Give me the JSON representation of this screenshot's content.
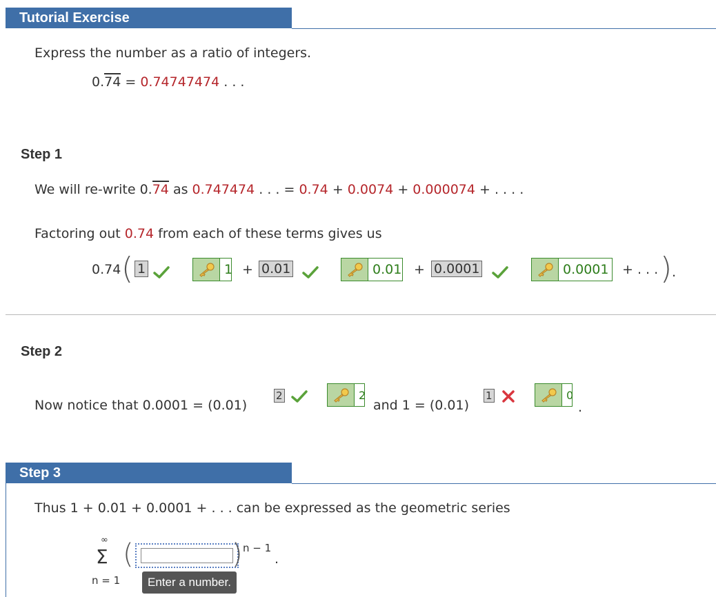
{
  "header": {
    "title": "Tutorial Exercise"
  },
  "problem": {
    "prompt": "Express the number as a ratio of integers.",
    "lhs_int": "0.",
    "lhs_rep": "74",
    "eq": "=",
    "rhs": "0.74747474",
    "dots": ". . ."
  },
  "step1": {
    "heading": "Step 1",
    "rewrite": {
      "t1": "We will re-write 0.",
      "rep": "74",
      "t2": "as",
      "v1": "0.747474",
      "t3": ". . . =",
      "a": "0.74",
      "p1": "+",
      "b": "0.0074",
      "p2": "+",
      "c": "0.000074",
      "tail": "+ . . . ."
    },
    "factor": {
      "t1": "Factoring out",
      "val": "0.74",
      "t2": "from each of these terms gives us"
    },
    "expr": {
      "coef": "0.74",
      "ans1": "1",
      "key1": "1",
      "plus1": "+",
      "ans2": "0.01",
      "key2": "0.01",
      "plus2": "+",
      "ans3": "0.0001",
      "key3": "0.0001",
      "tail": "+  . . .",
      "end": "."
    }
  },
  "step2": {
    "heading": "Step 2",
    "t1": "Now notice that 0.0001 = (0.01)",
    "exp1": "2",
    "key1": "2",
    "t2": "and 1 = (0.01)",
    "exp2": "1",
    "key2": "0",
    "end": "."
  },
  "step3": {
    "heading": "Step 3",
    "t1": "Thus 1 + 0.01 + 0.0001 +  . . .  can be expressed as the geometric series",
    "sum_top": "∞",
    "sum_sym": "Σ",
    "sum_bottom": "n = 1",
    "exponent": "n − 1",
    "end": ".",
    "tooltip": "Enter a number."
  },
  "colors": {
    "accent": "#3f6fa8",
    "correct": "#5aa23a",
    "incorrect": "#d9363e",
    "red_text": "#b5262b"
  }
}
